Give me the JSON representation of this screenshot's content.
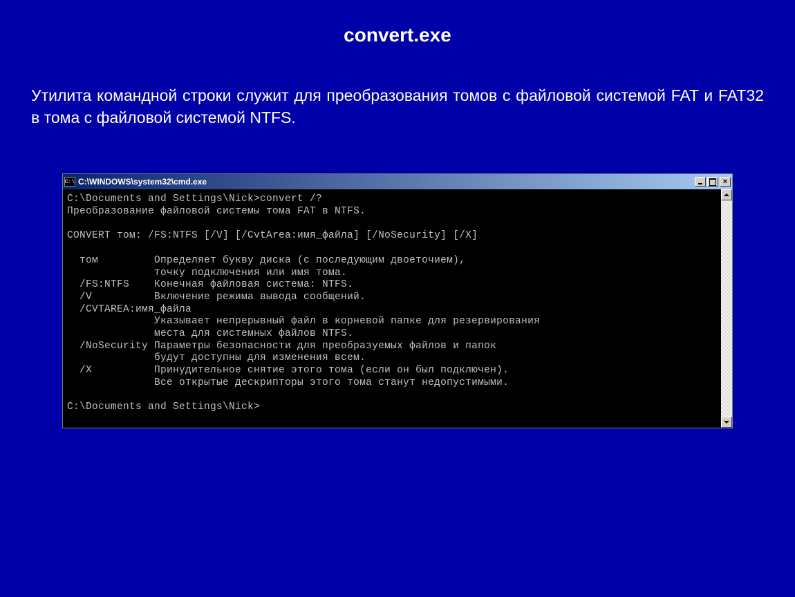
{
  "slide": {
    "title": "convert.exe",
    "description": "Утилита командной строки служит для преобразования томов с файловой системой FAT и FAT32 в тома с файловой системой NTFS."
  },
  "window": {
    "icon_label": "C:\\",
    "title": "C:\\WINDOWS\\system32\\cmd.exe"
  },
  "console": {
    "text": "C:\\Documents and Settings\\Nick>convert /?\nПреобразование файловой системы тома FAT в NTFS.\n\nCONVERT том: /FS:NTFS [/V] [/CvtArea:имя_файла] [/NoSecurity] [/X]\n\n  том         Определяет букву диска (с последующим двоеточием),\n              точку подключения или имя тома.\n  /FS:NTFS    Конечная файловая система: NTFS.\n  /V          Включение режима вывода сообщений.\n  /CVTAREA:имя_файла\n              Указывает непрерывный файл в корневой папке для резервирования\n              места для системных файлов NTFS.\n  /NoSecurity Параметры безопасности для преобразуемых файлов и папок\n              будут доступны для изменения всем.\n  /X          Принудительное снятие этого тома (если он был подключен).\n              Все открытые дескрипторы этого тома станут недопустимыми.\n\nC:\\Documents and Settings\\Nick>"
  }
}
